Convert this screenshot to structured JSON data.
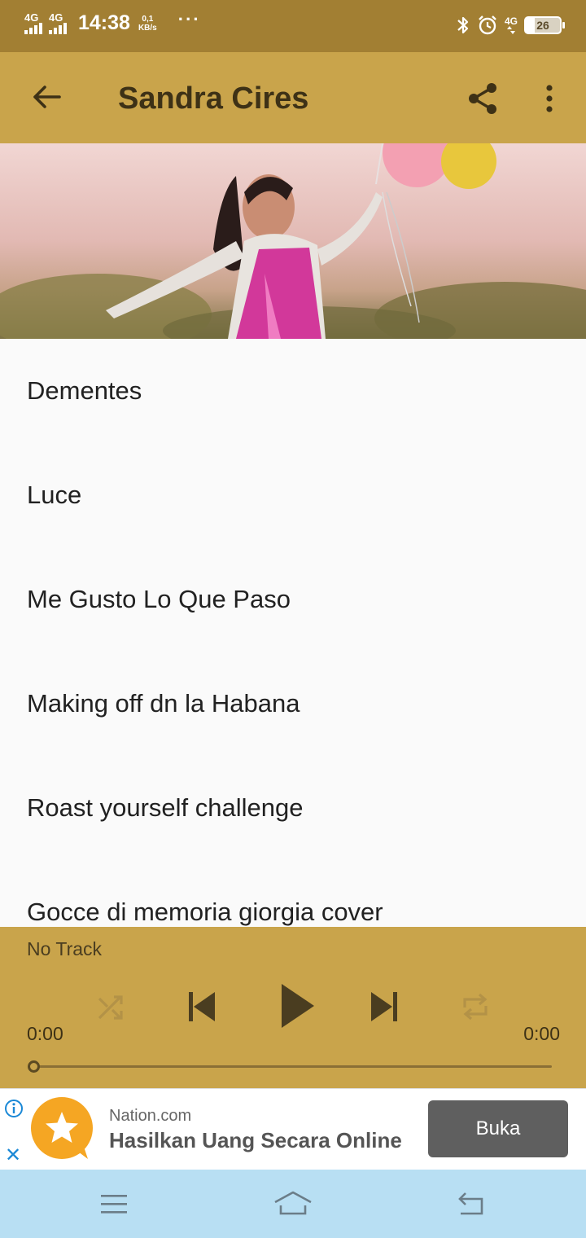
{
  "status_bar": {
    "signal1": "4G",
    "signal2": "4G",
    "time": "14:38",
    "speed_value": "0,1",
    "speed_unit": "KB/s",
    "dots": "···",
    "net": "4G",
    "battery": "26",
    "icons": [
      "bluetooth-icon",
      "alarm-icon"
    ]
  },
  "app_bar": {
    "title": "Sandra Cires",
    "icons": [
      "back-arrow-icon",
      "share-icon",
      "more-vert-icon"
    ],
    "color": "#c9a44b"
  },
  "tracks": [
    "Dementes",
    "Luce",
    "Me Gusto Lo Que Paso",
    "Making off dn la Habana",
    "Roast yourself challenge",
    "Gocce di memoria giorgia cover"
  ],
  "player": {
    "now_playing": "No Track",
    "elapsed": "0:00",
    "duration": "0:00",
    "progress": 0,
    "controls": [
      "shuffle-icon",
      "previous-icon",
      "play-icon",
      "next-icon",
      "repeat-icon"
    ]
  },
  "ad": {
    "source": "Nation.com",
    "headline": "Hasilkan Uang Secara Online",
    "button": "Buka",
    "close": "✕"
  },
  "nav_bar": {
    "icons": [
      "menu-icon",
      "home-icon",
      "back-icon"
    ]
  }
}
